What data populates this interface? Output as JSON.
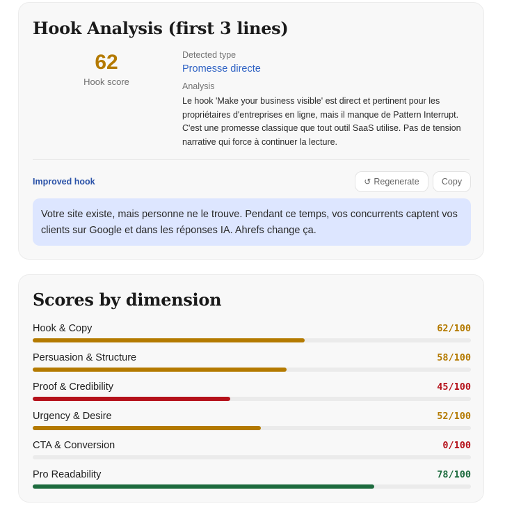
{
  "hook": {
    "title": "Hook Analysis (first 3 lines)",
    "score": "62",
    "score_label": "Hook score",
    "detected_type_label": "Detected type",
    "detected_type": "Promesse directe",
    "analysis_label": "Analysis",
    "analysis_text": "Le hook 'Make your business visible' est direct et pertinent pour les propriétaires d'entreprises en ligne, mais il manque de Pattern Interrupt. C'est une promesse classique que tout outil SaaS utilise. Pas de tension narrative qui force à continuer la lecture.",
    "improved_label": "Improved hook",
    "regenerate_label": "Regenerate",
    "copy_label": "Copy",
    "improved_text": "Votre site existe, mais personne ne le trouve. Pendant ce temps, vos concurrents captent vos clients sur Google et dans les réponses IA. Ahrefs change ça."
  },
  "scores": {
    "title": "Scores by dimension",
    "dimensions": [
      {
        "name": "Hook & Copy",
        "value": 62,
        "display": "62/100",
        "color": "#b47a00"
      },
      {
        "name": "Persuasion & Structure",
        "value": 58,
        "display": "58/100",
        "color": "#b47a00"
      },
      {
        "name": "Proof & Credibility",
        "value": 45,
        "display": "45/100",
        "color": "#b5121b"
      },
      {
        "name": "Urgency & Desire",
        "value": 52,
        "display": "52/100",
        "color": "#b47a00"
      },
      {
        "name": "CTA & Conversion",
        "value": 0,
        "display": "0/100",
        "color": "#b5121b"
      },
      {
        "name": "Pro Readability",
        "value": 78,
        "display": "78/100",
        "color": "#1d6b3e"
      }
    ]
  },
  "colors": {
    "accent_blue": "#2f62c4",
    "score_amber": "#b47a00",
    "improved_bg": "#dde6ff"
  }
}
